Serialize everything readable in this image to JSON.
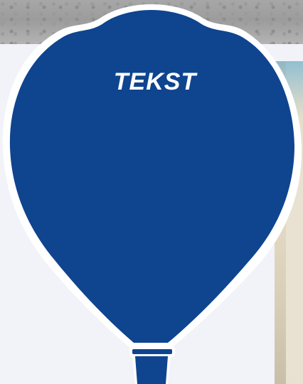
{
  "balloon": {
    "text": "TEKST"
  },
  "colors": {
    "balloon_blue": "#0f448f",
    "outline_white": "#ffffff",
    "panel_bg": "#f1f3f9",
    "top_bg": "#a5a5a5"
  },
  "icon": "hot-air-balloon-icon"
}
